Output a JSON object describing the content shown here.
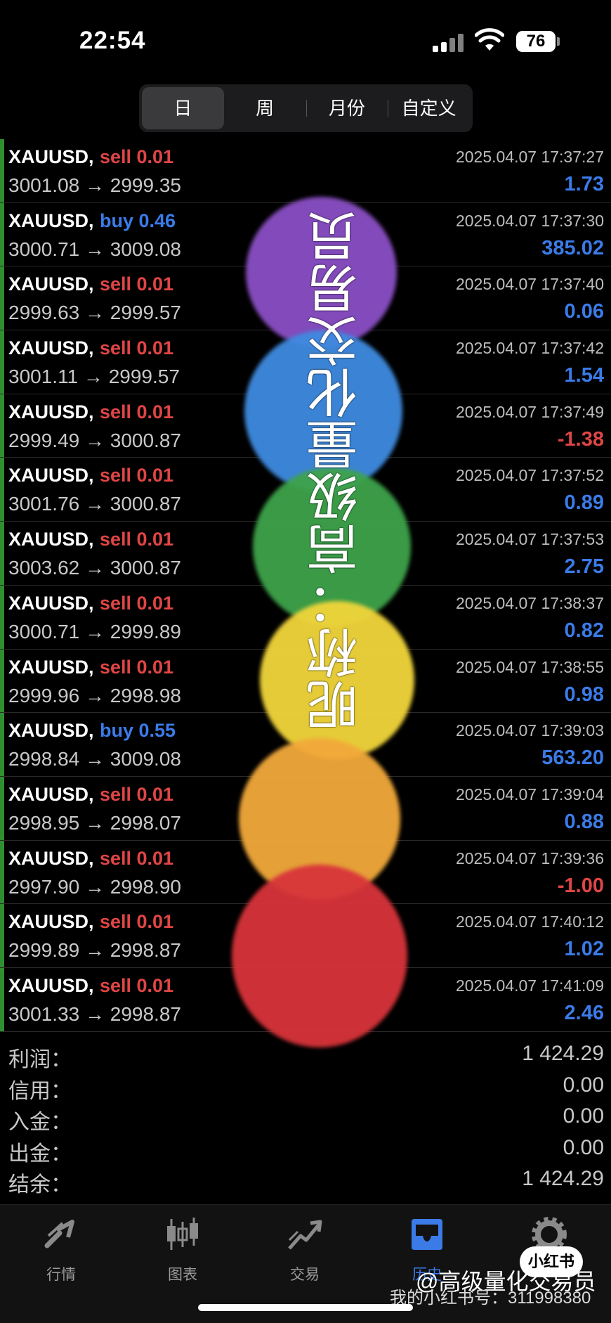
{
  "status_bar": {
    "time": "22:54",
    "battery": "76"
  },
  "period_tabs": [
    "日",
    "周",
    "月份",
    "自定义"
  ],
  "active_period": "日",
  "trades": [
    {
      "symbol": "XAUUSD,",
      "side": "sell",
      "side_label": "sell 0.01",
      "prices": "3001.08 → 2999.35",
      "time": "2025.04.07 17:37:27",
      "profit": "1.73",
      "sign": "pos"
    },
    {
      "symbol": "XAUUSD,",
      "side": "buy",
      "side_label": "buy 0.46",
      "prices": "3000.71 → 3009.08",
      "time": "2025.04.07 17:37:30",
      "profit": "385.02",
      "sign": "pos"
    },
    {
      "symbol": "XAUUSD,",
      "side": "sell",
      "side_label": "sell 0.01",
      "prices": "2999.63 → 2999.57",
      "time": "2025.04.07 17:37:40",
      "profit": "0.06",
      "sign": "pos"
    },
    {
      "symbol": "XAUUSD,",
      "side": "sell",
      "side_label": "sell 0.01",
      "prices": "3001.11 → 2999.57",
      "time": "2025.04.07 17:37:42",
      "profit": "1.54",
      "sign": "pos"
    },
    {
      "symbol": "XAUUSD,",
      "side": "sell",
      "side_label": "sell 0.01",
      "prices": "2999.49 → 3000.87",
      "time": "2025.04.07 17:37:49",
      "profit": "-1.38",
      "sign": "neg"
    },
    {
      "symbol": "XAUUSD,",
      "side": "sell",
      "side_label": "sell 0.01",
      "prices": "3001.76 → 3000.87",
      "time": "2025.04.07 17:37:52",
      "profit": "0.89",
      "sign": "pos"
    },
    {
      "symbol": "XAUUSD,",
      "side": "sell",
      "side_label": "sell 0.01",
      "prices": "3003.62 → 3000.87",
      "time": "2025.04.07 17:37:53",
      "profit": "2.75",
      "sign": "pos"
    },
    {
      "symbol": "XAUUSD,",
      "side": "sell",
      "side_label": "sell 0.01",
      "prices": "3000.71 → 2999.89",
      "time": "2025.04.07 17:38:37",
      "profit": "0.82",
      "sign": "pos"
    },
    {
      "symbol": "XAUUSD,",
      "side": "sell",
      "side_label": "sell 0.01",
      "prices": "2999.96 → 2998.98",
      "time": "2025.04.07 17:38:55",
      "profit": "0.98",
      "sign": "pos"
    },
    {
      "symbol": "XAUUSD,",
      "side": "buy",
      "side_label": "buy 0.55",
      "prices": "2998.84 → 3009.08",
      "time": "2025.04.07 17:39:03",
      "profit": "563.20",
      "sign": "pos"
    },
    {
      "symbol": "XAUUSD,",
      "side": "sell",
      "side_label": "sell 0.01",
      "prices": "2998.95 → 2998.07",
      "time": "2025.04.07 17:39:04",
      "profit": "0.88",
      "sign": "pos"
    },
    {
      "symbol": "XAUUSD,",
      "side": "sell",
      "side_label": "sell 0.01",
      "prices": "2997.90 → 2998.90",
      "time": "2025.04.07 17:39:36",
      "profit": "-1.00",
      "sign": "neg"
    },
    {
      "symbol": "XAUUSD,",
      "side": "sell",
      "side_label": "sell 0.01",
      "prices": "2999.89 → 2998.87",
      "time": "2025.04.07 17:40:12",
      "profit": "1.02",
      "sign": "pos"
    },
    {
      "symbol": "XAUUSD,",
      "side": "sell",
      "side_label": "sell 0.01",
      "prices": "3001.33 → 2998.87",
      "time": "2025.04.07 17:41:09",
      "profit": "2.46",
      "sign": "pos"
    }
  ],
  "summary": [
    {
      "label": "利润：",
      "value": "1 424.29"
    },
    {
      "label": "信用：",
      "value": "0.00"
    },
    {
      "label": "入金：",
      "value": "0.00"
    },
    {
      "label": "出金：",
      "value": "0.00"
    },
    {
      "label": "结余：",
      "value": "1 424.29"
    }
  ],
  "overlay_text": "昵称：高级量化交易员",
  "overlay_colors": [
    "#8a4fc4",
    "#3f8be0",
    "#3ea34a",
    "#f2d63a",
    "#f2a93a",
    "#d8343a"
  ],
  "tabbar": [
    {
      "label": "行情",
      "icon": "quotes-icon"
    },
    {
      "label": "图表",
      "icon": "chart-icon"
    },
    {
      "label": "交易",
      "icon": "trade-icon"
    },
    {
      "label": "历史",
      "icon": "history-icon"
    },
    {
      "label": "设置",
      "icon": "settings-icon"
    }
  ],
  "active_tab": "历史",
  "badge": "小红书",
  "watermark_name": "@高级量化交易员",
  "watermark_id": "我的小红书号：311998380"
}
